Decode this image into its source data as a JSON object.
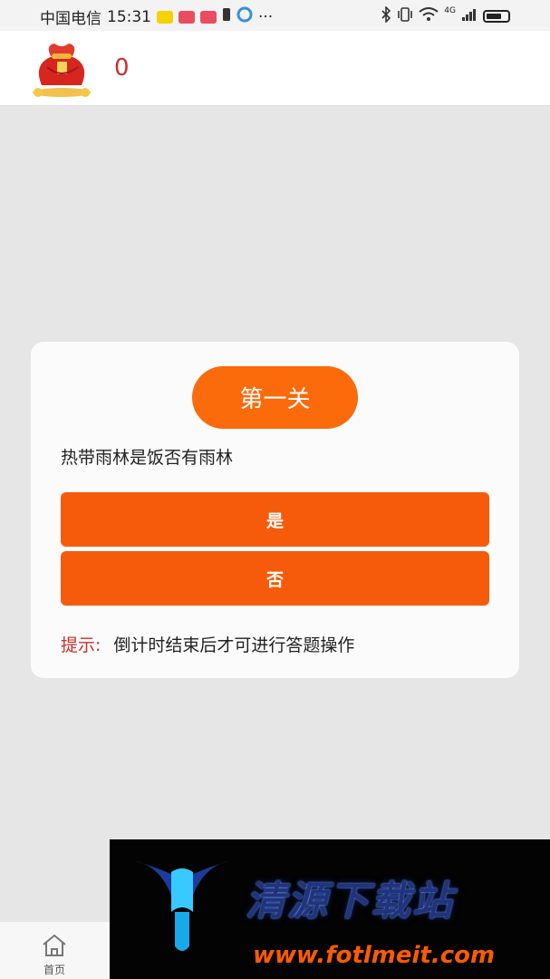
{
  "status_bar": {
    "carrier": "中国电信",
    "time": "15:31",
    "more": "···",
    "network": "4G"
  },
  "header": {
    "coin_count": "0",
    "icon": "money-bag-icon"
  },
  "quiz": {
    "level": "第一关",
    "question": "热带雨林是饭否有雨林",
    "yes_label": "是",
    "no_label": "否",
    "hint_label": "提示:",
    "hint_text": "倒计时结束后才可进行答题操作"
  },
  "tabbar": {
    "home_label": "首页",
    "home_icon": "home-icon"
  },
  "watermark": {
    "name": "清源下载站",
    "url": "www.fotlmeit.com"
  },
  "colors": {
    "accent": "#f65b0b",
    "badge": "#fb6a0b",
    "coin_text": "#c9302c",
    "background": "#e6e6e6"
  }
}
